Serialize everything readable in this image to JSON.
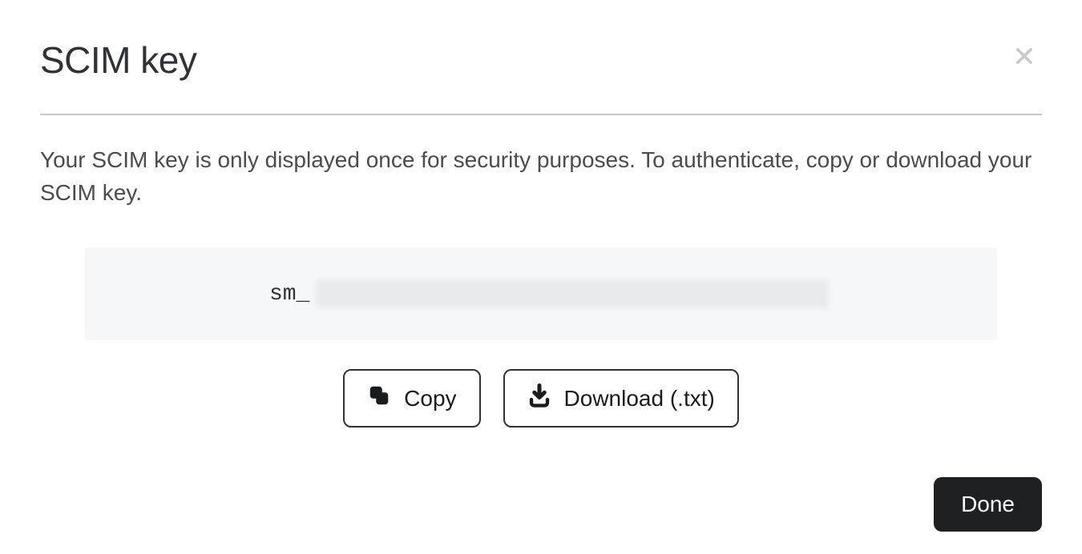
{
  "dialog": {
    "title": "SCIM key",
    "description": "Your SCIM key is only displayed once for security purposes. To authenticate, copy or download your SCIM key.",
    "key_prefix": "sm_",
    "copy_label": "Copy",
    "download_label": "Download (.txt)",
    "done_label": "Done"
  }
}
